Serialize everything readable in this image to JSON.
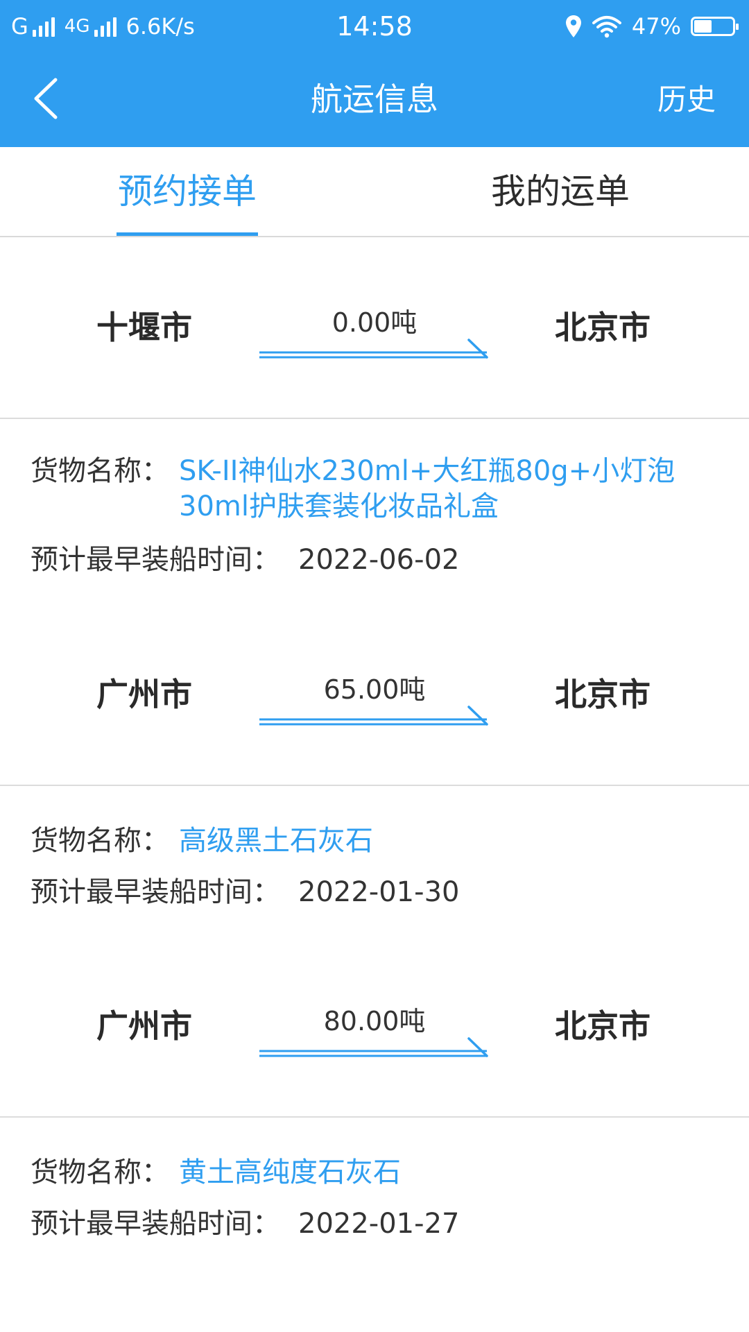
{
  "status_bar": {
    "carrier": "G",
    "network": "4G",
    "speed": "6.6K/s",
    "time": "14:58",
    "battery": "47%",
    "battery_level": 0.47
  },
  "nav": {
    "title": "航运信息",
    "history_label": "历史",
    "back_icon": "chevron-left-icon"
  },
  "tabs": [
    {
      "label": "预约接单",
      "active": true
    },
    {
      "label": "我的运单",
      "active": false
    }
  ],
  "colors": {
    "primary": "#2f9ef0",
    "text": "#2c2c2c",
    "divider": "#dcdcdc"
  },
  "labels": {
    "goods": "货物名称：",
    "loading_date": "预计最早装船时间："
  },
  "orders": [
    {
      "from": "十堰市",
      "to": "北京市",
      "tonnage": "0.00吨",
      "goods": "SK-II神仙水230ml+大红瓶80g+小灯泡30ml护肤套装化妆品礼盒",
      "date": "2022-06-02"
    },
    {
      "from": "广州市",
      "to": "北京市",
      "tonnage": "65.00吨",
      "goods": "高级黑土石灰石",
      "date": "2022-01-30"
    },
    {
      "from": "广州市",
      "to": "北京市",
      "tonnage": "80.00吨",
      "goods": "黄土高纯度石灰石",
      "date": "2022-01-27"
    }
  ]
}
